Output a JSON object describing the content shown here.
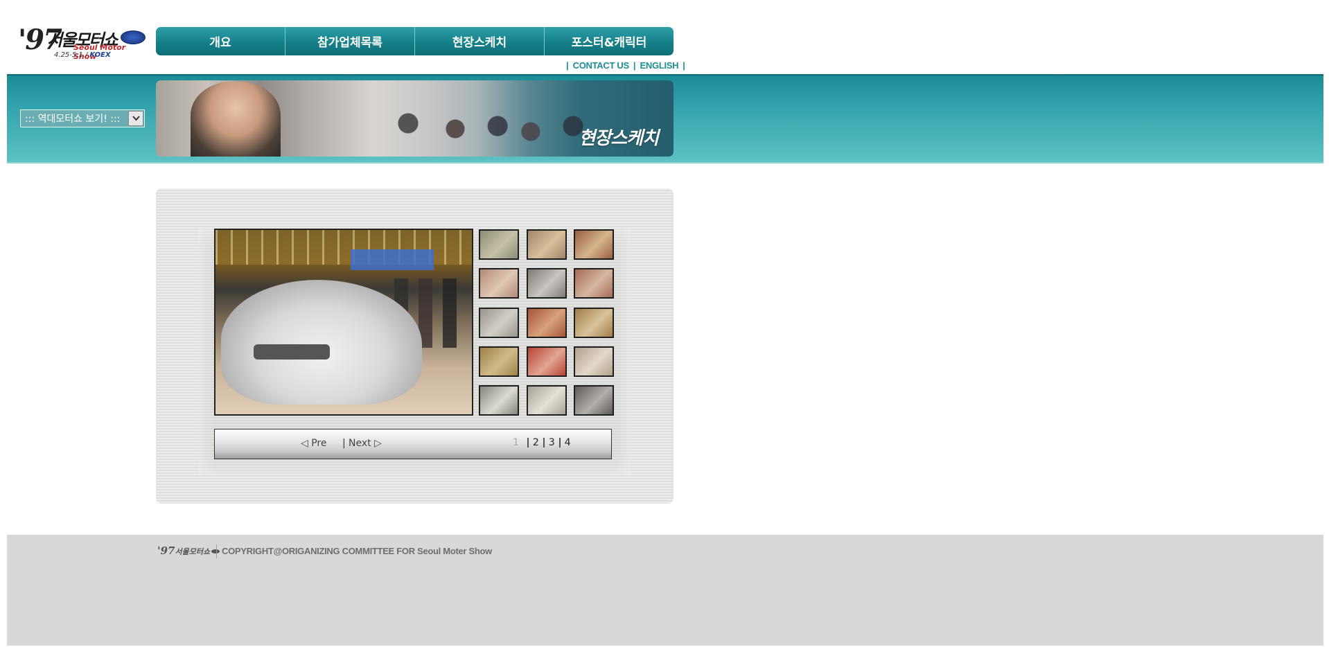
{
  "logo": {
    "year": "'97",
    "title_kr": "서울모터쇼",
    "title_en": "Seoul Motor Show",
    "dates": "4.25-5.1",
    "venue": "KOEX"
  },
  "nav": {
    "items": [
      {
        "label": "개요"
      },
      {
        "label": "참가업체목록"
      },
      {
        "label": "현장스케치"
      },
      {
        "label": "포스터&캐릭터"
      }
    ]
  },
  "util_links": {
    "contact": "CONTACT US",
    "english": "ENGLISH"
  },
  "archive_select": {
    "value": "::: 역대모터쇼 보기! :::",
    "arrow": "chevron-down-icon"
  },
  "banner": {
    "title": "현장스케치"
  },
  "gallery": {
    "thumbnails": [
      {
        "colors": [
          "#8d8b74",
          "#c6c2a8"
        ]
      },
      {
        "colors": [
          "#a1866b",
          "#d7c09a"
        ]
      },
      {
        "colors": [
          "#9a5f43",
          "#d4b58c"
        ]
      },
      {
        "colors": [
          "#b08a78",
          "#e0c9b4"
        ]
      },
      {
        "colors": [
          "#7d7a76",
          "#c9c6c0"
        ]
      },
      {
        "colors": [
          "#a36a55",
          "#d6b7a2"
        ]
      },
      {
        "colors": [
          "#98938b",
          "#d2cfc9"
        ]
      },
      {
        "colors": [
          "#a45436",
          "#d9a27c"
        ]
      },
      {
        "colors": [
          "#a07c4b",
          "#d9c39a"
        ]
      },
      {
        "colors": [
          "#9b8146",
          "#d1bb88"
        ]
      },
      {
        "colors": [
          "#b84237",
          "#e0a58f"
        ]
      },
      {
        "colors": [
          "#b2a18c",
          "#e3d8ca"
        ]
      },
      {
        "colors": [
          "#85867f",
          "#dcdad2"
        ]
      },
      {
        "colors": [
          "#a7a197",
          "#e5e1d8"
        ]
      },
      {
        "colors": [
          "#5e5b57",
          "#b3b0aa"
        ]
      }
    ],
    "pager": {
      "prev": "◁ Pre",
      "separator": "|",
      "next": "Next ▷",
      "current": "1",
      "pages": [
        "2",
        "3",
        "4"
      ]
    }
  },
  "footer": {
    "logo_year": "'97",
    "logo_kr": "서울모터쇼",
    "copyright": "COPYRIGHT@ORIGANIZING COMMITTEE FOR Seoul Moter Show"
  }
}
